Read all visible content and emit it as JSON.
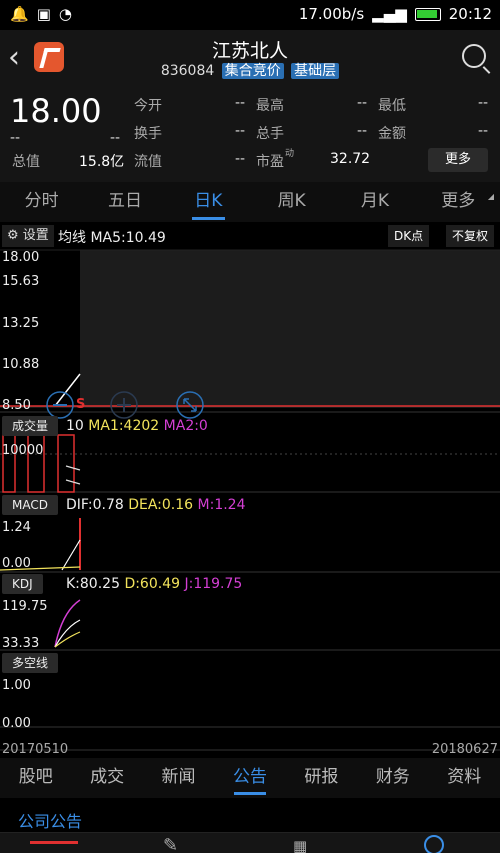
{
  "status": {
    "speed": "17.00b/s",
    "time": "20:12"
  },
  "header": {
    "title": "江苏北人",
    "code": "836084",
    "tag1": "集合竞价",
    "tag2": "基础层"
  },
  "quote": {
    "price": "18.00",
    "dash": "--",
    "labels": {
      "open": "今开",
      "high": "最高",
      "low": "最低",
      "turnover_rate": "换手",
      "volume": "总手",
      "amount": "金额",
      "total_value": "总值",
      "float_value": "流值",
      "pe": "市盈",
      "pe_sup": "动"
    },
    "values": {
      "open": "--",
      "high": "--",
      "low": "--",
      "turnover_rate": "--",
      "volume": "--",
      "amount": "--",
      "total_value": "15.8亿",
      "float_value": "--",
      "pe": "32.72"
    },
    "more": "更多"
  },
  "period_tabs": [
    "分时",
    "五日",
    "日K",
    "周K",
    "月K",
    "更多"
  ],
  "chart": {
    "settings": "设置",
    "ma_label": "均线 MA5:10.49",
    "dk_btn": "DK点",
    "fq_btn": "不复权",
    "s_marker": "S",
    "price_ticks": [
      "18.00",
      "15.63",
      "13.25",
      "10.88",
      "8.50"
    ],
    "volume_btn": "成交量",
    "vol_text": "10",
    "vol_ma1": "MA1:4202",
    "vol_ma2": "MA2:0",
    "vol_tick": "10000",
    "macd_btn": "MACD",
    "dif": "DIF:0.78",
    "dea": "DEA:0.16",
    "m": "M:1.24",
    "macd_ticks": [
      "1.24",
      "0.00"
    ],
    "kdj_btn": "KDJ",
    "k": "K:80.25",
    "d": "D:60.49",
    "j": "J:119.75",
    "kdj_ticks": [
      "119.75",
      "33.33"
    ],
    "dkx_btn": "多空线",
    "dkx_ticks": [
      "1.00",
      "0.00"
    ],
    "date_start": "20170510",
    "date_end": "20180627"
  },
  "bottom_tabs": [
    "股吧",
    "成交",
    "新闻",
    "公告",
    "研报",
    "财务",
    "资料"
  ],
  "announcement_title": "公司公告",
  "colors": {
    "accent": "#3a8ee6",
    "red": "#e03030",
    "yellow": "#f2e35c",
    "magenta": "#d43fd4"
  }
}
